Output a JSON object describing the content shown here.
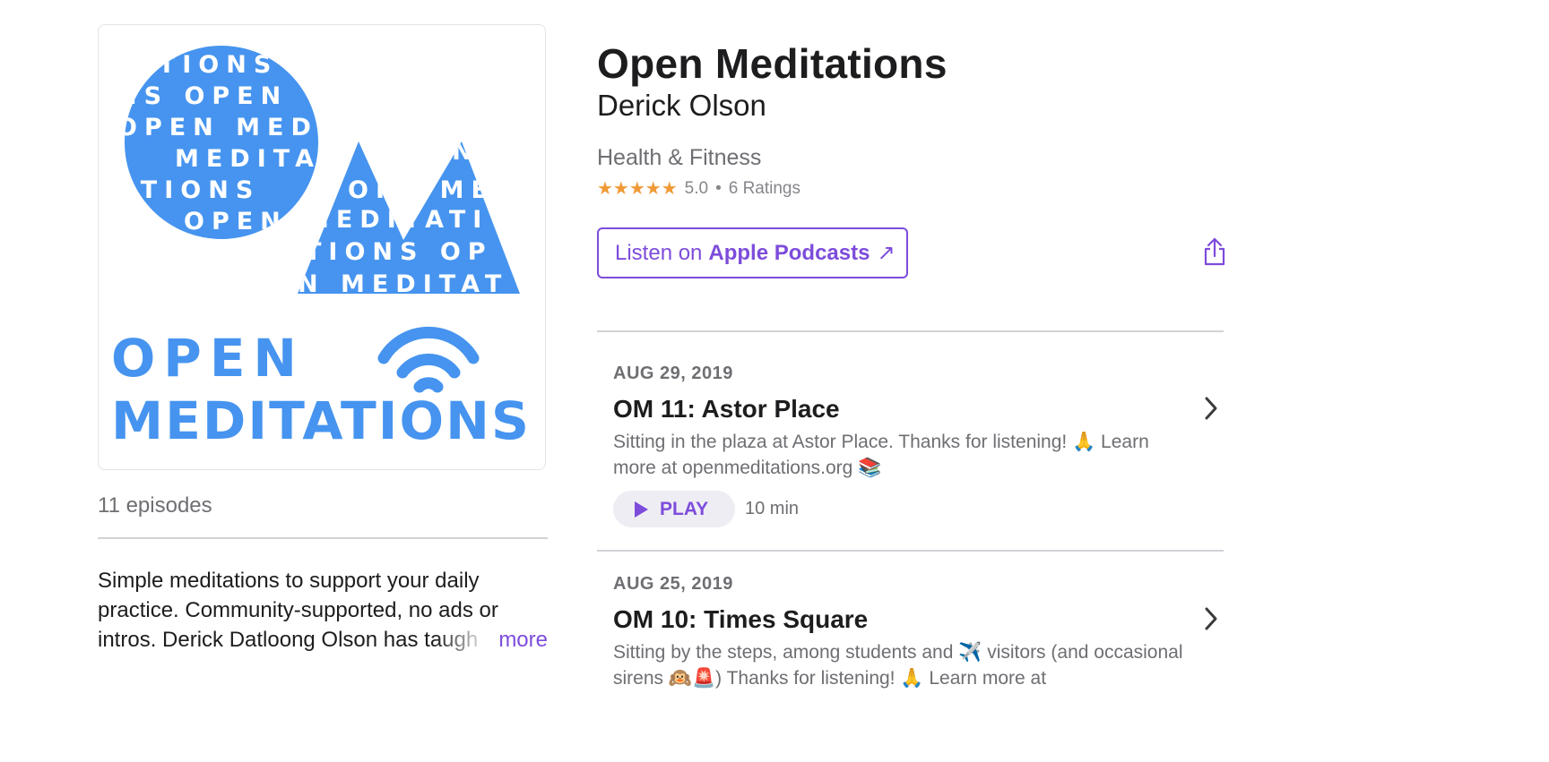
{
  "podcast": {
    "title": "Open Meditations",
    "author": "Derick Olson",
    "category": "Health & Fitness",
    "rating": {
      "stars": "★★★★★",
      "score": "5.0",
      "separator": "•",
      "count": "6 Ratings",
      "value": 5.0
    },
    "listen_button": {
      "prefix": "Listen on",
      "brand": "Apple Podcasts",
      "arrow": "↗"
    }
  },
  "artwork": {
    "logo_text_line1": "OPEN",
    "logo_text_line2": "MEDITATIONS",
    "pattern_text": "OPEN MEDITATIONS",
    "colors": {
      "accent": "#4694ef"
    }
  },
  "sidebar": {
    "episode_count": "11 episodes",
    "description": "Simple meditations to support your daily practice. Community-supported, no ads or intros. Derick Datloong Olson has taugh",
    "more_label": "more"
  },
  "episodes": [
    {
      "date": "AUG 29, 2019",
      "title": "OM 11: Astor Place",
      "description": "Sitting in the plaza at Astor Place. Thanks for listening! 🙏 Learn more at openmeditations.org 📚",
      "play_label": "PLAY",
      "duration": "10 min"
    },
    {
      "date": "AUG 25, 2019",
      "title": "OM 10: Times Square",
      "description": "Sitting by the steps, among students and ✈️ visitors (and occasional sirens 🙉🚨) Thanks for listening! 🙏 Learn more at"
    }
  ],
  "colors": {
    "accent": "#7d4cdb",
    "star": "#f09a37",
    "secondary_text": "#6e6e73"
  },
  "icons": [
    "share-icon",
    "chevron-right-icon",
    "play-icon",
    "external-arrow-icon"
  ]
}
